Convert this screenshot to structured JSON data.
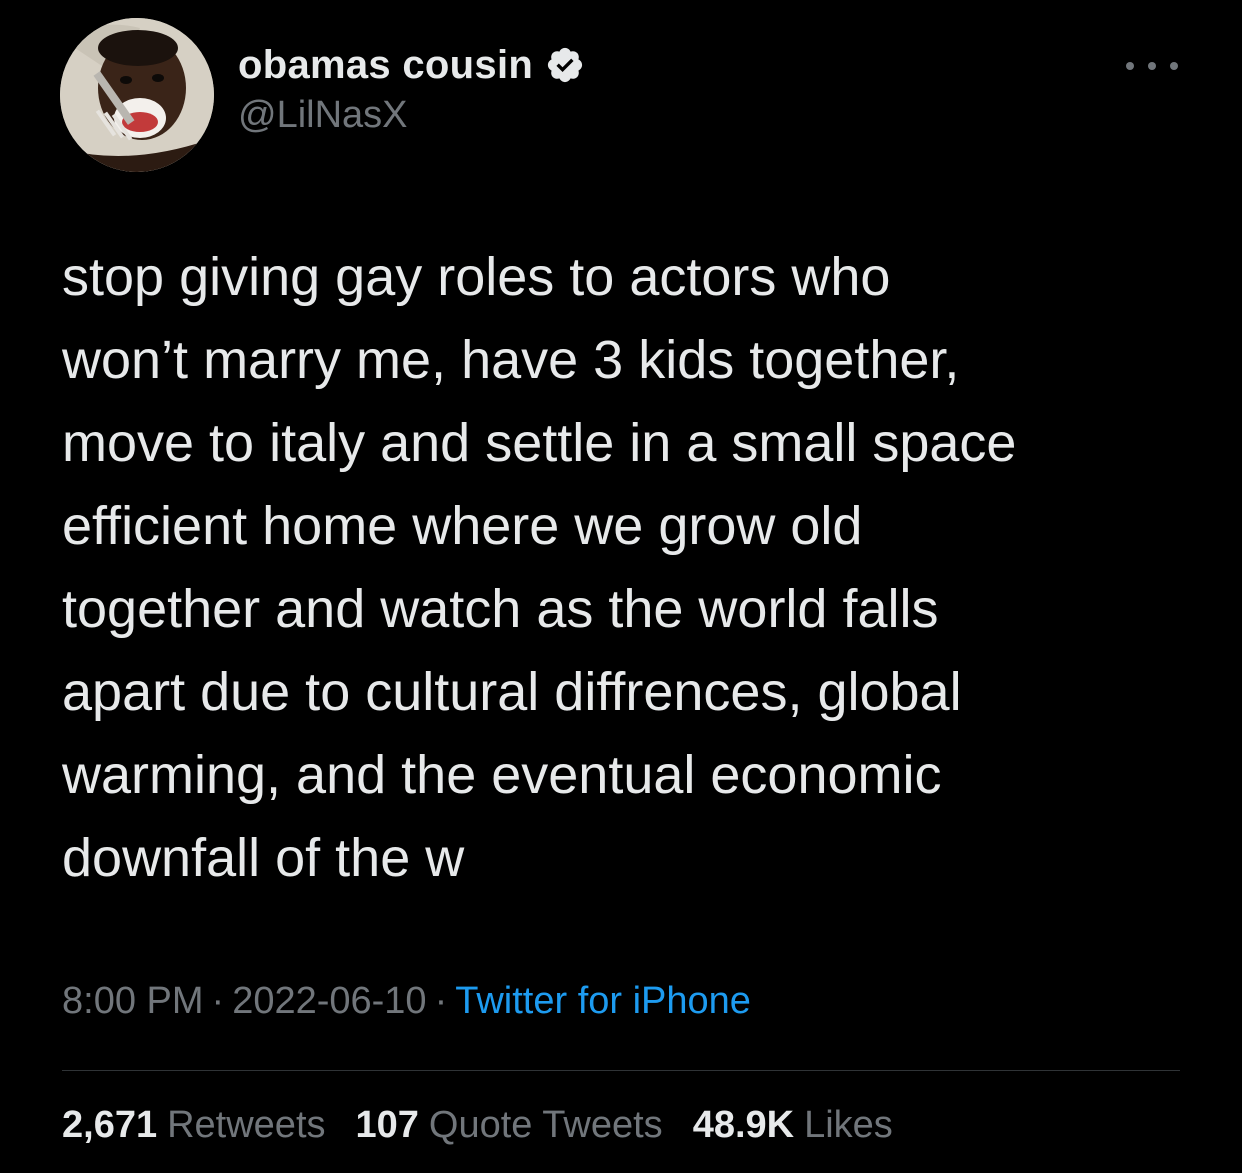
{
  "author": {
    "display_name": "obamas cousin",
    "handle": "@LilNasX",
    "verified": true,
    "avatar_icon": "profile-photo"
  },
  "tweet": {
    "text_lines": [
      "stop giving gay roles to actors who",
      "won’t marry me, have 3 kids together,",
      "move to italy and settle in a small space",
      "efficient home where we grow old",
      "together and watch as the world falls",
      "apart due to cultural diffrences, global",
      "warming, and the eventual economic",
      "downfall of the w"
    ],
    "time": "8:00 PM",
    "separator": "·",
    "date": "2022-06-10",
    "source": "Twitter for iPhone"
  },
  "stats": {
    "retweets_count": "2,671",
    "retweets_label": "Retweets",
    "quotes_count": "107",
    "quotes_label": "Quote Tweets",
    "likes_count": "48.9K",
    "likes_label": "Likes"
  },
  "colors": {
    "background": "#000000",
    "text_primary": "#e7e9ea",
    "text_secondary": "#71767b",
    "link": "#1d9bf0",
    "divider": "#2f3336"
  },
  "icons": {
    "verified": "verified-badge-icon",
    "more": "more-options-icon"
  }
}
